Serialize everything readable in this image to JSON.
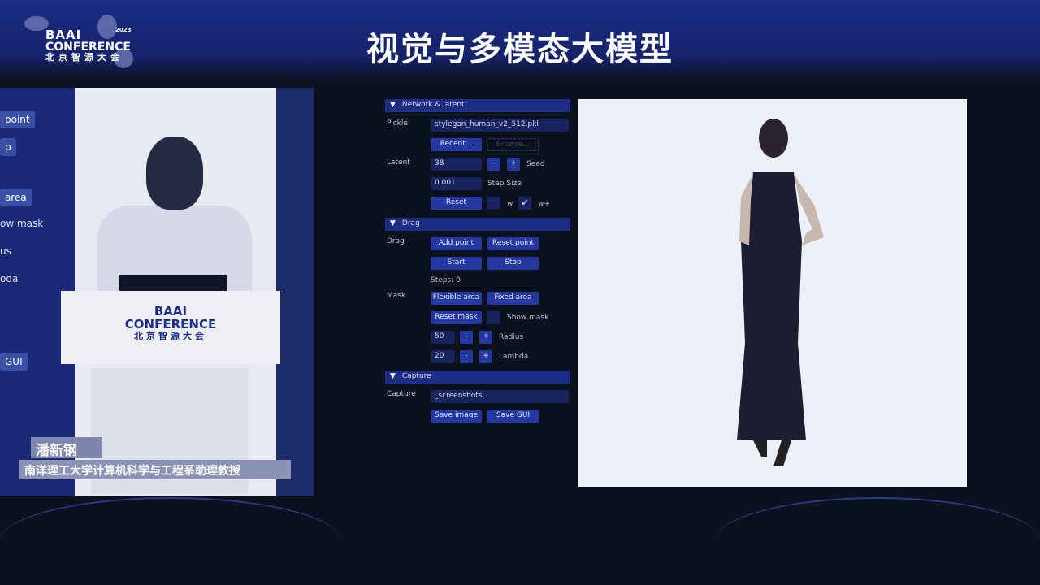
{
  "slide": {
    "title": "视觉与多模态大模型"
  },
  "logo": {
    "line1": "BAAI",
    "line2": "CONFERENCE",
    "line3": "北京智源大会",
    "year": "2023"
  },
  "video": {
    "left_gui_fragments": [
      "point",
      "p",
      "area",
      "ow mask",
      "us",
      "oda",
      "GUI"
    ],
    "podium_logo": {
      "line1": "BAAI",
      "line2": "CONFERENCE",
      "line3": "北京智源大会"
    },
    "speaker_name": "潘新钢",
    "speaker_title": "南洋理工大学计算机科学与工程系助理教授"
  },
  "gui": {
    "network": {
      "header": "Network & latent",
      "pickle_label": "Pickle",
      "pickle_value": "stylegan_human_v2_512.pkl",
      "recent": "Recent...",
      "browse": "Browse...",
      "latent_label": "Latent",
      "seed_value": "38",
      "minus": "-",
      "plus": "+",
      "seed_label": "Seed",
      "step_value": "0.001",
      "step_label": "Step Size",
      "reset": "Reset",
      "w_label": "w",
      "wplus_label": "w+",
      "w_checked": false,
      "wplus_checked": true
    },
    "drag": {
      "header": "Drag",
      "drag_label": "Drag",
      "add_point": "Add point",
      "reset_point": "Reset point",
      "start": "Start",
      "stop": "Stop",
      "steps": "Steps: 0",
      "mask_label": "Mask",
      "flexible_area": "Flexible area",
      "fixed_area": "Fixed area",
      "reset_mask": "Reset mask",
      "show_mask": "Show mask",
      "show_mask_checked": false,
      "radius_value": "50",
      "radius_label": "Radius",
      "lambda_value": "20",
      "lambda_label": "Lambda",
      "minus": "-",
      "plus": "+"
    },
    "capture": {
      "header": "Capture",
      "capture_label": "Capture",
      "dir_value": "_screenshots",
      "save_image": "Save image",
      "save_gui": "Save GUI"
    }
  },
  "colors": {
    "accent": "#2338a0",
    "background": "#0c121d",
    "header_band": "#1b2c86"
  }
}
